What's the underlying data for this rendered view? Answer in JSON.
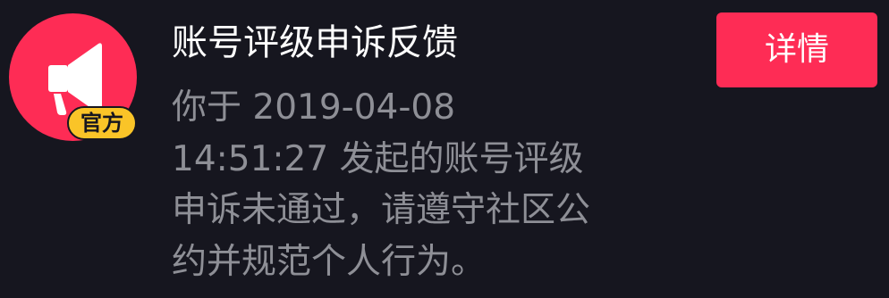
{
  "notification": {
    "title": "账号评级申诉反馈",
    "avatar_icon": "megaphone-icon",
    "official_badge": "官方",
    "message_lines": [
      "你于 2019-04-08",
      "14:51:27 发起的账号评级",
      "申诉未通过，请遵守社区公",
      "约并规范个人行为。"
    ],
    "detail_button_label": "详情"
  },
  "colors": {
    "background": "#16161f",
    "accent": "#fe2c55",
    "badge": "#fac428",
    "title_text": "#ffffff",
    "body_text": "#8e8f96"
  }
}
